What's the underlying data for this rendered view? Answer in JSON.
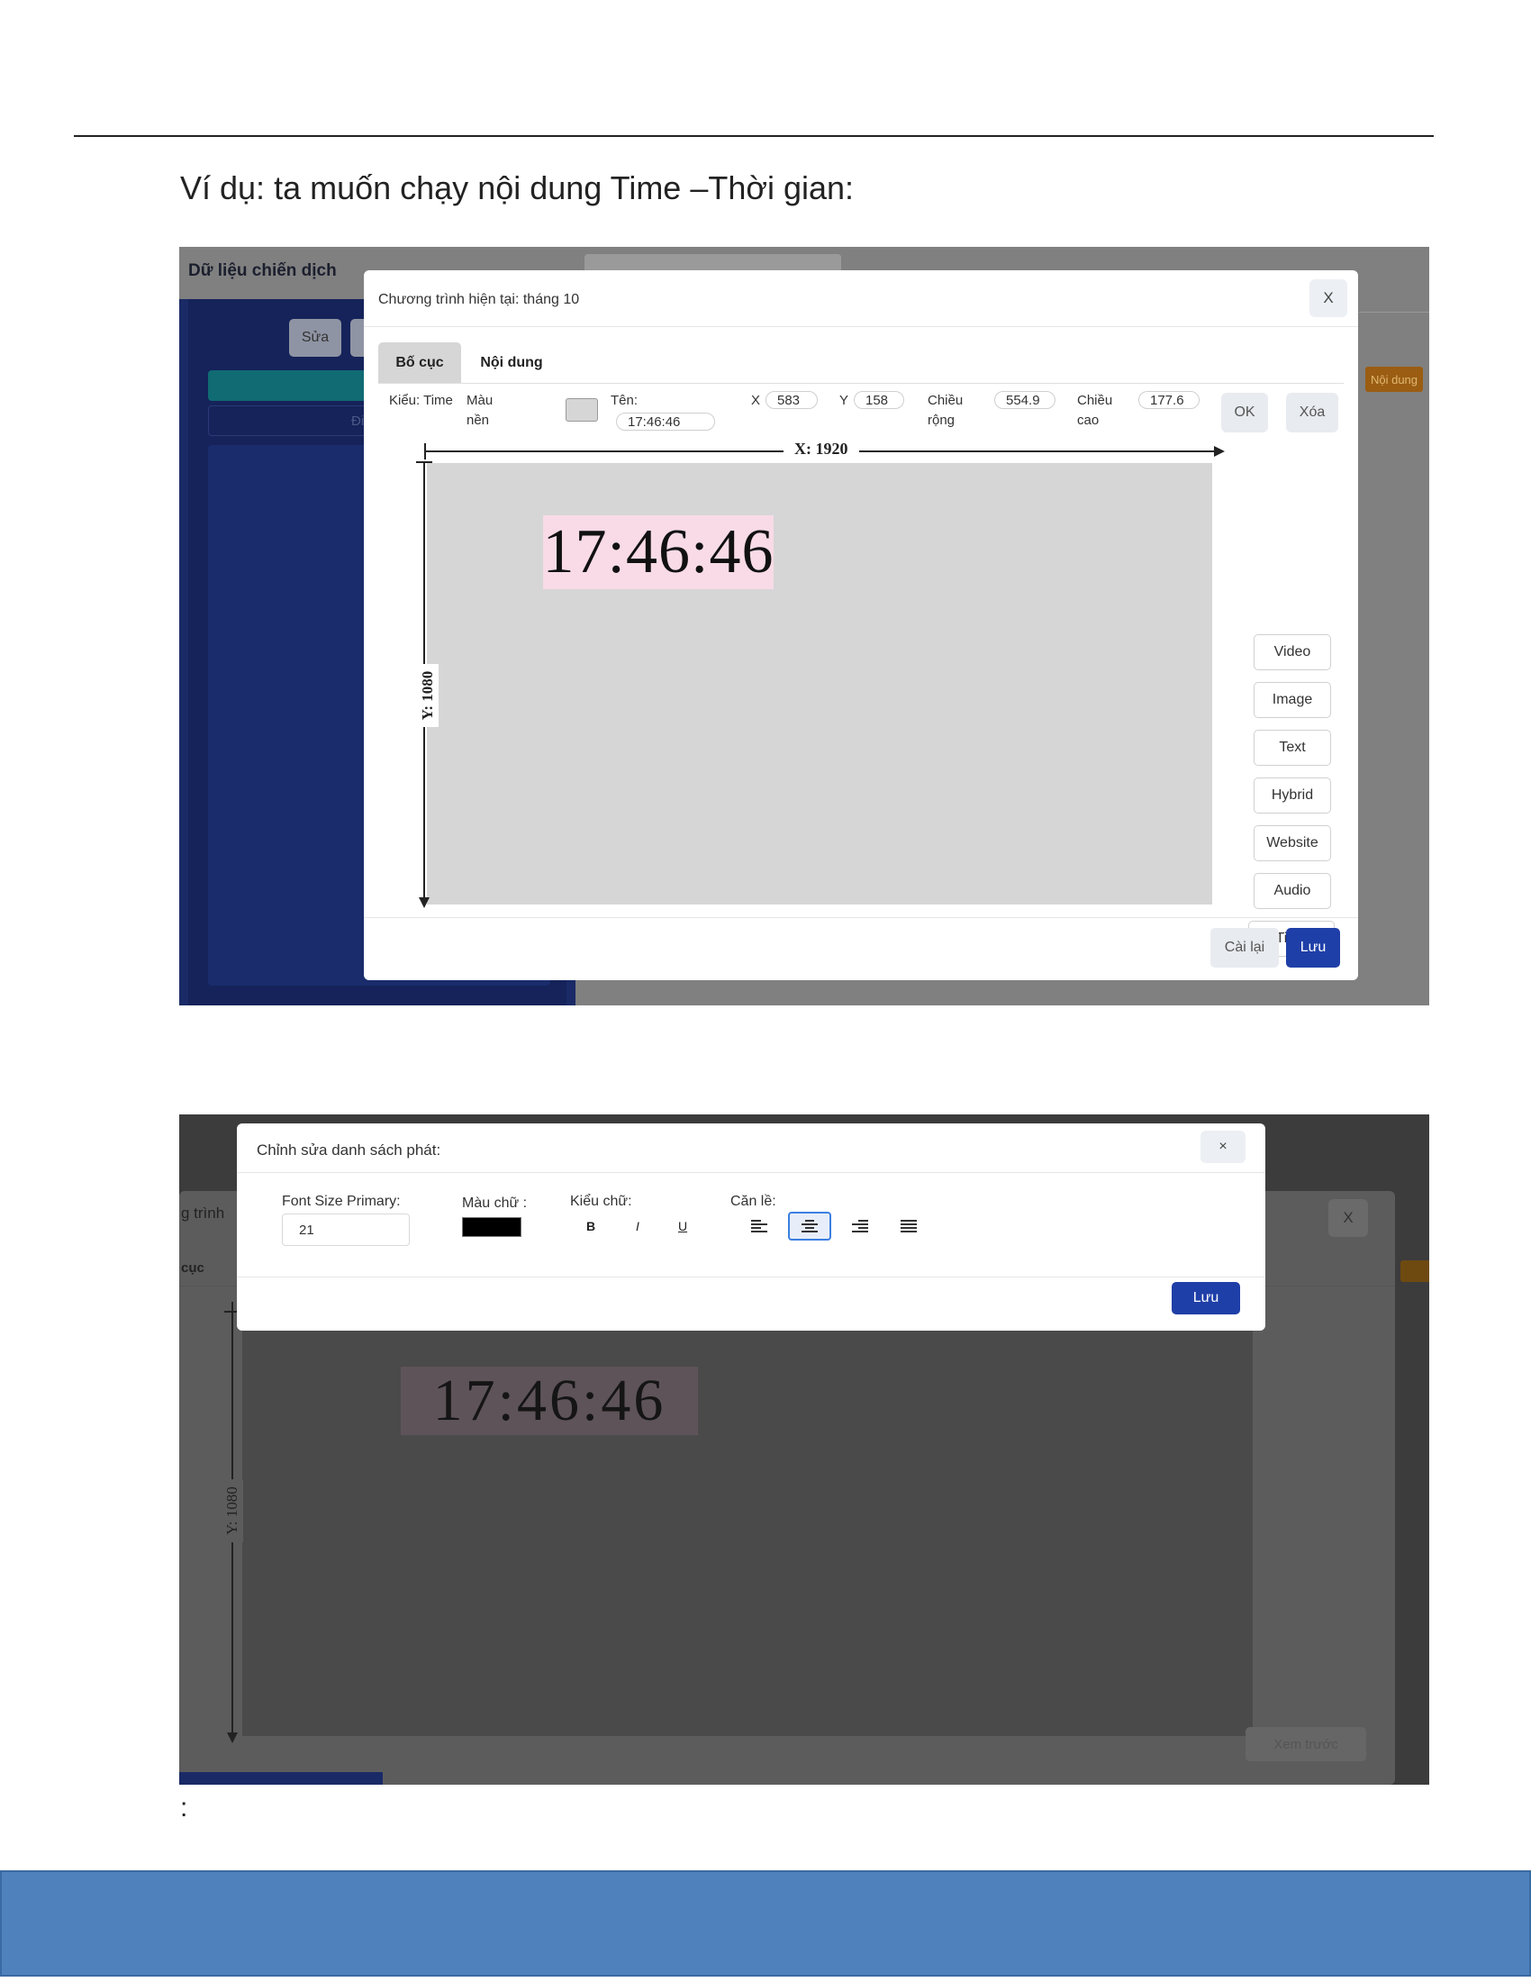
{
  "document": {
    "intro": "Ví dụ: ta muốn chạy nội dung Time –Thời gian:",
    "trailing_colon": ":"
  },
  "shot1": {
    "background": {
      "title": "Dữ liệu chiến dịch",
      "edit_button": "Sửa",
      "sidebar_partial": "Đi",
      "badge": "Nội dung"
    },
    "modal": {
      "title": "Chương trình hiện tại: tháng 10",
      "close": "X",
      "tabs": [
        "Bố cục",
        "Nội dung"
      ],
      "props": {
        "type_label": "Kiểu: Time",
        "bg_label_1": "Màu",
        "bg_label_2": "nền",
        "bg_color": "#d6d6d6",
        "name_label": "Tên:",
        "name_value": "17:46:46",
        "x_label": "X",
        "x_value": "583",
        "y_label": "Y",
        "y_value": "158",
        "w_label_1": "Chiều",
        "w_label_2": "rộng",
        "w_value": "554.9",
        "h_label_1": "Chiều",
        "h_label_2": "cao",
        "h_value": "177.6",
        "ok": "OK",
        "delete": "Xóa"
      },
      "canvas": {
        "x_label": "X: 1920",
        "y_label": "Y: 1080",
        "clock_text": "17:46:46"
      },
      "side_buttons": [
        "Video",
        "Image",
        "Text",
        "Hybrid",
        "Website",
        "Audio",
        "Time"
      ],
      "reset": "Cài lại",
      "save": "Lưu"
    }
  },
  "shot2": {
    "background": {
      "title_partial": "g trình",
      "close": "X",
      "tab_partial": "cục",
      "y_label": "Y: 1080",
      "clock_text": "17:46:46",
      "preview": "Xem trước"
    },
    "modal": {
      "title": "Chỉnh sửa danh sách phát:",
      "close": "×",
      "font_size_label": "Font Size Primary:",
      "font_size_value": "21",
      "color_label": "Màu chữ :",
      "text_color": "#000000",
      "style_label": "Kiểu chữ:",
      "bold": "B",
      "italic": "I",
      "underline": "U",
      "align_label": "Căn lề:",
      "align_active": "center",
      "save": "Lưu"
    }
  },
  "colors": {
    "primary": "#1f3fa8",
    "footer": "#4f81bd"
  }
}
